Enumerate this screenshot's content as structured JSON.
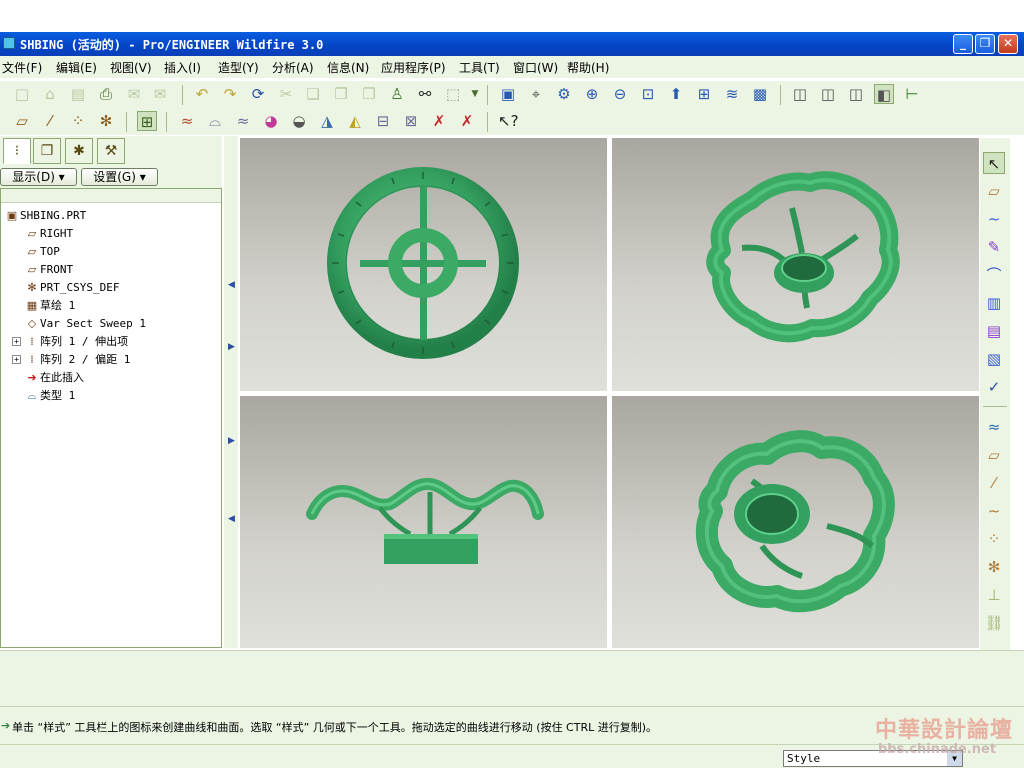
{
  "window": {
    "title": "SHBING (活动的) - Pro/ENGINEER Wildfire 3.0",
    "minimize": "_",
    "maximize": "❐",
    "close": "✕"
  },
  "menu": {
    "file": "文件(F)",
    "edit": "编辑(E)",
    "view": "视图(V)",
    "insert": "插入(I)",
    "styling": "造型(Y)",
    "analysis": "分析(A)",
    "info": "信息(N)",
    "applications": "应用程序(P)",
    "tools": "工具(T)",
    "window": "窗口(W)",
    "help": "帮助(H)"
  },
  "navigator": {
    "show_button": "显示(D) ▾",
    "settings_button": "设置(G) ▾",
    "tree": [
      {
        "label": "SHBING.PRT",
        "icon": "part-icon",
        "glyph": "▣"
      },
      {
        "label": "RIGHT",
        "icon": "datum-plane-icon",
        "glyph": "▱"
      },
      {
        "label": "TOP",
        "icon": "datum-plane-icon",
        "glyph": "▱"
      },
      {
        "label": "FRONT",
        "icon": "datum-plane-icon",
        "glyph": "▱"
      },
      {
        "label": "PRT_CSYS_DEF",
        "icon": "coordinate-system-icon",
        "glyph": "✻"
      },
      {
        "label": "草绘 1",
        "icon": "sketch-icon",
        "glyph": "▦"
      },
      {
        "label": "Var Sect Sweep 1",
        "icon": "sweep-icon",
        "glyph": "◇"
      },
      {
        "label": "阵列 1 / 伸出项",
        "icon": "pattern-icon",
        "glyph": "⁞"
      },
      {
        "label": "阵列 2 / 偏距 1",
        "icon": "pattern-icon",
        "glyph": "⁞"
      },
      {
        "label": "在此插入",
        "icon": "insert-here-icon",
        "glyph": "➜"
      },
      {
        "label": "类型 1",
        "icon": "style-feature-icon",
        "glyph": "⌓"
      }
    ]
  },
  "message": {
    "text": "单击 “样式” 工具栏上的图标来创建曲线和曲面。选取 “样式” 几何或下一个工具。拖动选定的曲线进行移动 (按住 CTRL 进行复制)。"
  },
  "status": {
    "style_select": "Style"
  },
  "watermark": {
    "title": "中華設計論壇",
    "url": "bbs.chinade.net"
  },
  "colors": {
    "ui_background": "#ecf5e3",
    "model_green": "#3aaa64",
    "title_blue": "#0545c8",
    "viewport_top": "#a9a79f",
    "viewport_bottom": "#e0e0db"
  }
}
